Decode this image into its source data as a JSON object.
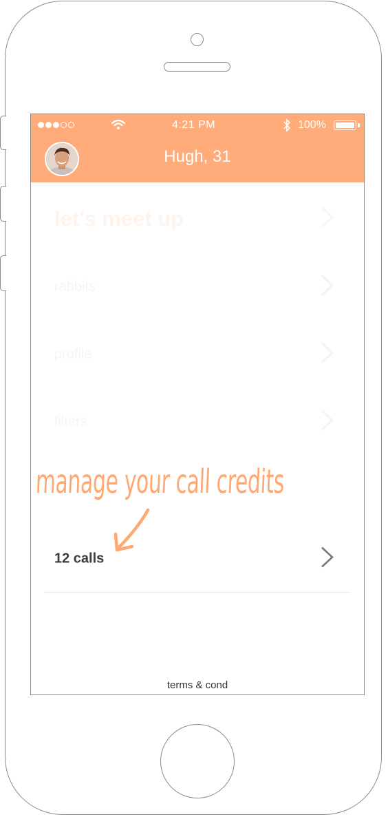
{
  "status_bar": {
    "time": "4:21 PM",
    "battery_percent": "100%",
    "signal_full": 3,
    "signal_total": 5
  },
  "header": {
    "title": "Hugh, 31",
    "avatar_icon": "user-avatar-photo"
  },
  "menu": {
    "items": [
      {
        "label": "let's meet up",
        "icon": "chevron-right-icon"
      },
      {
        "label": "rabbits",
        "icon": "chevron-right-icon"
      },
      {
        "label": "profile",
        "icon": "chevron-right-icon"
      },
      {
        "label": "filters",
        "icon": "chevron-right-icon"
      }
    ],
    "calls": {
      "label": "12 calls",
      "icon": "chevron-right-icon"
    }
  },
  "annotation": "manage your call credits",
  "footer": {
    "terms": "terms & cond"
  },
  "colors": {
    "accent": "#ffac7a",
    "annotation": "#ffa872",
    "calls_text": "#3b3b3b"
  }
}
